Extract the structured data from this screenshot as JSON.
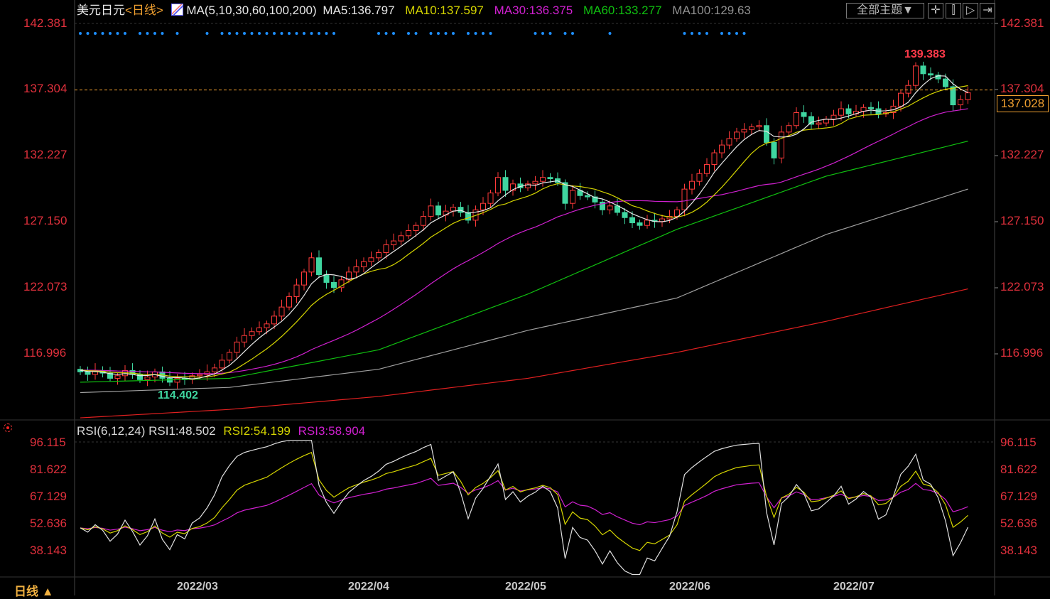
{
  "header": {
    "symbol": "美元日元",
    "period": "<日线>",
    "ma_params": "MA(5,10,30,60,100,200)",
    "ma5": "MA5:136.797",
    "ma10": "MA10:137.597",
    "ma30": "MA30:136.375",
    "ma60": "MA60:133.277",
    "ma100": "MA100:129.63",
    "theme_button": "全部主题▼"
  },
  "rsi_header": {
    "params": "RSI(6,12,24)",
    "rsi1": "RSI1:48.502",
    "rsi2": "RSI2:54.199",
    "rsi3": "RSI3:58.904"
  },
  "footer": {
    "period_button": "日线 ▲"
  },
  "colors": {
    "up": "#ff3a3a",
    "down": "#3fd6a0",
    "ma5": "#e8e8e8",
    "ma10": "#d4d400",
    "ma30": "#d020d0",
    "ma60": "#10c010",
    "ma100": "#a0a0a0",
    "ma200": "#e02020",
    "price_line": "#f0a030",
    "axis_text": "#e0303c",
    "signal": "#1e8fff"
  },
  "chart_data": {
    "type": "candlestick",
    "title": "美元日元 日线",
    "price_axis": {
      "ticks": [
        "142.381",
        "137.304",
        "132.227",
        "127.150",
        "122.073",
        "116.996"
      ],
      "range": [
        110.0,
        143.5
      ]
    },
    "last_price": "137.028",
    "annotations": {
      "high": "139.383",
      "low": "114.402"
    },
    "x_ticks": [
      {
        "index": 17,
        "label": "2022/03"
      },
      {
        "index": 39,
        "label": "2022/04"
      },
      {
        "index": 60,
        "label": "2022/05"
      },
      {
        "index": 82,
        "label": "2022/06"
      },
      {
        "index": 104,
        "label": "2022/07"
      }
    ],
    "close": [
      115.5,
      115.3,
      115.6,
      115.4,
      115.0,
      115.2,
      115.6,
      115.3,
      114.9,
      115.1,
      115.5,
      115.0,
      114.7,
      115.0,
      114.9,
      115.2,
      115.3,
      115.5,
      115.8,
      116.4,
      117.0,
      117.8,
      118.3,
      118.6,
      118.9,
      119.2,
      119.8,
      120.5,
      121.3,
      122.2,
      123.2,
      124.3,
      123.0,
      122.4,
      122.0,
      122.6,
      123.2,
      123.6,
      124.0,
      124.3,
      124.7,
      125.3,
      125.6,
      126.0,
      126.4,
      126.8,
      127.5,
      128.3,
      127.6,
      127.9,
      128.2,
      127.8,
      127.2,
      128.0,
      128.5,
      129.3,
      130.5,
      129.5,
      130.0,
      129.7,
      130.0,
      130.2,
      130.5,
      130.4,
      130.1,
      128.5,
      129.5,
      129.1,
      129.0,
      128.6,
      128.0,
      128.3,
      127.8,
      127.4,
      127.0,
      126.8,
      127.2,
      127.1,
      127.3,
      127.5,
      128.0,
      129.6,
      130.2,
      130.8,
      131.5,
      132.4,
      133.0,
      133.5,
      134.0,
      134.2,
      134.4,
      134.5,
      133.2,
      132.0,
      134.0,
      134.5,
      135.5,
      135.2,
      134.6,
      134.7,
      135.0,
      135.3,
      135.8,
      135.4,
      135.6,
      135.9,
      135.8,
      135.4,
      135.5,
      136.0,
      137.0,
      137.6,
      139.1,
      138.5,
      138.4,
      138.1,
      137.5,
      136.1,
      136.5,
      137.028
    ],
    "ma_long": {
      "sample_index": [
        0,
        20,
        40,
        60,
        80,
        100,
        119
      ],
      "MA60": [
        114.7,
        115.0,
        117.2,
        121.5,
        126.5,
        130.6,
        133.3
      ],
      "MA100": [
        113.9,
        114.3,
        115.7,
        118.7,
        121.2,
        126.1,
        129.6
      ],
      "MA200": [
        111.95,
        112.6,
        113.6,
        115.0,
        117.0,
        119.4,
        121.9
      ]
    },
    "signal_indices": [
      0,
      1,
      2,
      3,
      4,
      5,
      6,
      8,
      9,
      10,
      11,
      13,
      17,
      19,
      20,
      21,
      22,
      23,
      24,
      25,
      26,
      27,
      28,
      29,
      30,
      31,
      32,
      33,
      34,
      40,
      41,
      42,
      44,
      45,
      47,
      48,
      49,
      50,
      52,
      53,
      54,
      55,
      61,
      62,
      63,
      65,
      66,
      71,
      81,
      82,
      83,
      84,
      86,
      87,
      88,
      89
    ],
    "rsi_axis": {
      "ticks": [
        "96.115",
        "81.622",
        "67.129",
        "52.636",
        "38.143"
      ],
      "range": [
        24.5,
        100
      ]
    }
  }
}
